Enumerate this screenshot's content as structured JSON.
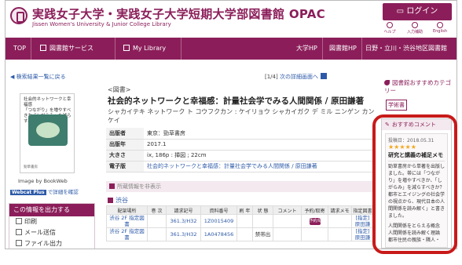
{
  "header": {
    "title_jp": "実践女子大学・実践女子大学短期大学部図書館 OPAC",
    "title_en": "Jissen Women's University & Junior College Library",
    "login_label": "ログイン",
    "icons": [
      {
        "name": "help-icon",
        "label": "ヘルプ"
      },
      {
        "name": "input-history-icon",
        "label": "入力補助"
      },
      {
        "name": "english-icon",
        "label": "English"
      }
    ]
  },
  "nav": {
    "items": [
      "TOP",
      "図書館サービス",
      "My Library",
      "大学HP",
      "図書館HP",
      "日野・立川・渋谷地区図書館"
    ]
  },
  "left": {
    "back_link": "検索結果一覧に戻る",
    "cover": {
      "title": "社会的ネットワークと幸福感",
      "subtitle": "「つながり」を増やすべきか「しがらみ」を減らすべきか",
      "publisher": "勁草書房"
    },
    "caption": "Image by BookWeb",
    "webcat_badge": "Webcat Plus",
    "webcat_link": "で詳細を確認",
    "output": {
      "head": "この情報を出力する",
      "items": [
        {
          "icon": "print-icon",
          "label": "印刷"
        },
        {
          "icon": "mail-icon",
          "label": "メール送信"
        },
        {
          "icon": "file-icon",
          "label": "ファイル出力"
        }
      ]
    }
  },
  "main": {
    "pager_text": "[1/4]",
    "pager_link": "次の詳細画面へ",
    "type": "<図書>",
    "title": "社会的ネットワークと幸福感：計量社会学でみる人間関係 / 原田謙著",
    "kana": "シャカイテキ ネットワーク ト コウフクカン : ケイリョウ シャカイガク デ ミル ニンゲン カンケイ",
    "meta": [
      {
        "key": "出版者",
        "value": "東京：勁草書房"
      },
      {
        "key": "出版年",
        "value": "2017.1"
      },
      {
        "key": "大きさ",
        "value": "ix, 186p : 挿図 ; 22cm"
      },
      {
        "key": "電子版",
        "value": "社会的ネットワークと幸福感：計量社会学でみる人間関係 / 原田謙著",
        "link": true
      }
    ],
    "holdings_bar": "所蔵情報を非表示",
    "location": "渋谷",
    "holdings": {
      "headers": [
        "配架場所",
        "巻 次",
        "請求記号",
        "資料番号",
        "刷 年",
        "状 態",
        "コメント",
        "予約/取寄",
        "請求メモ",
        "指定図書"
      ],
      "rows": [
        {
          "place": "渋谷 2F 指定図書",
          "vol": "",
          "callno": "361.3/H32",
          "id": "1Z0015409",
          "year": "",
          "status": "",
          "comment": "",
          "resv": "予約/取寄",
          "memo": "",
          "designated": "[指定] 原田謙"
        },
        {
          "place": "渋谷 2F 指定図書",
          "vol": "",
          "callno": "361.3/H32",
          "id": "1A0478456",
          "year": "",
          "status": "禁帯出",
          "comment": "",
          "resv": "",
          "memo": "",
          "designated": "[指定] 原田謙"
        }
      ]
    }
  },
  "right": {
    "recommend_head": "図書館おすすめカテゴリー",
    "tag": "学術書",
    "comment_head": "おすすめコメント",
    "comment": {
      "date": "投稿日：2018.05.31",
      "stars": "★★★★★",
      "rating": 5,
      "title": "研究と講義の補足メモ",
      "paragraphs": [
        "勁草書房から単著を出版しました。帯には「つながり」を増やすべきか、「しがらみ」を減らすべきか？都市とエイジングの社会学の視点から、現代日本の人間関係を読み解く」と書きました。",
        "人間関係をとらえる概念 人間関係を読み解く理論 都市住民の親族・隣人・"
      ]
    }
  },
  "colors": {
    "brand": "#8b1e5a",
    "link": "#2d5aa8",
    "highlight_ring": "#c81a1a",
    "stars": "#f2a81d"
  }
}
